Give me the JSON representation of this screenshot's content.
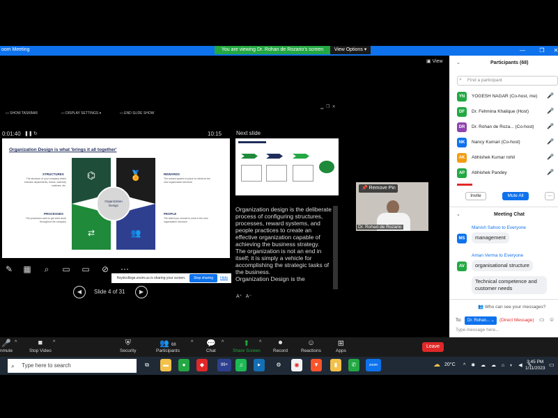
{
  "window": {
    "app_title": "oom Meeting",
    "viewing_banner": "You are viewing Dr. Rohan de Rozario's screen",
    "view_options": "View Options ▾",
    "view_button": "View"
  },
  "ppt": {
    "show_taskbar": "SHOW TASKBAR",
    "display_settings": "DISPLAY SETTINGS ▾",
    "end_slide_show": "END SLIDE SHOW",
    "elapsed": "0:01:40",
    "clock": "10:15",
    "next_slide_label": "Next slide",
    "slide_indicator": "Slide 4 of 31",
    "slide": {
      "title_bold": "Organization Design",
      "title_rest": " is what 'brings it all together'",
      "center": "Organization Design",
      "structures_label": "STRUCTURES",
      "structures_text": "The structure of your company which includes departments, teams, authority matrixes, etc.",
      "rewards_label": "REWARDS",
      "rewards_text": "The reward system in place to reinforce the new organization structure",
      "processes_label": "PROCESSES",
      "processes_text": "The processes used to get work done throughout the company",
      "people_label": "PEOPLE",
      "people_text": "The talent you choose to work in the new organization structure"
    },
    "notes": "Organization design is the deliberate process of configuring structures, processes, reward systems, and people practices to create an effective organization capable of achieving the business strategy.\nThe organization is not an end in itself; it is simply a vehicle for accomplishing the strategic tasks of the business.\nOrganization Design is the"
  },
  "presenter": {
    "remove_pin": "Remove Pin",
    "name": "Dr. Rohan de Rozario"
  },
  "share_banner": {
    "text": "floydcollege.zoom.us is sharing your screen.",
    "stop": "Stop sharing",
    "hide": "Hide"
  },
  "participants": {
    "title": "Participants (68)",
    "search_placeholder": "Find a participant",
    "list": [
      {
        "initials": "YN",
        "name": "YOGESH NAGAR (Co-host, me)",
        "color": "#23a843"
      },
      {
        "initials": "DF",
        "name": "Dr. Fehmina Khalique (Host)",
        "color": "#23a843"
      },
      {
        "initials": "DR",
        "name": "Dr. Rohan de Roza... (Co-host)",
        "color": "#8e44ad"
      },
      {
        "initials": "NK",
        "name": "Nancy Kumari (Co-host)",
        "color": "#0e72ed"
      },
      {
        "initials": "AK",
        "name": "Abhishek Kumar rohit",
        "color": "#f39c12"
      },
      {
        "initials": "AP",
        "name": "Abhishek Pandey",
        "color": "#23a843"
      }
    ],
    "invite": "Invite",
    "mute_all": "Mute All",
    "more": "..."
  },
  "chat": {
    "title": "Meeting Chat",
    "messages": [
      {
        "sender": "Manish Sahoo to Everyone",
        "initials": "MS",
        "color": "#0e72ed",
        "text": "management"
      },
      {
        "sender": "Aman Verma to Everyone",
        "initials": "AV",
        "color": "#23a843",
        "text": "organisational structure"
      },
      {
        "text": "Technical competence and customer needs"
      }
    ],
    "who_can_see": "Who can see your messages?",
    "to_label": "To:",
    "to_value": "Dr. Rohan...",
    "direct_message": "(Direct Message)",
    "input_placeholder": "Type message here..."
  },
  "toolbar": {
    "unmute": "nmute",
    "stop_video": "Stop Video",
    "security": "Security",
    "participants": "Participants",
    "participants_count": "68",
    "chat": "Chat",
    "share_screen": "Share Screen",
    "record": "Record",
    "reactions": "Reactions",
    "apps": "Apps",
    "leave": "Leave"
  },
  "taskbar": {
    "search_placeholder": "Type here to search",
    "temperature": "20°C",
    "time": "3:45 PM",
    "date": "1/11/2023",
    "badge": "99+"
  }
}
